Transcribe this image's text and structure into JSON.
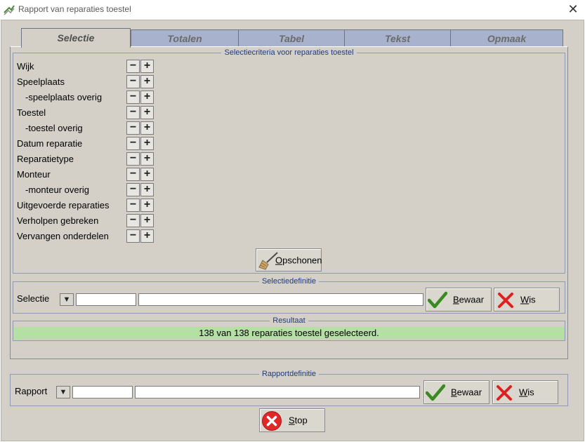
{
  "window": {
    "title": "Rapport van reparaties toestel",
    "close_glyph": "✕"
  },
  "tabs": [
    "Selectie",
    "Totalen",
    "Tabel",
    "Tekst",
    "Opmaak"
  ],
  "criteria": {
    "legend": "Selectiecriteria voor reparaties toestel",
    "items": [
      {
        "label": "Wijk",
        "sub": false
      },
      {
        "label": "Speelplaats",
        "sub": false
      },
      {
        "label": "-speelplaats overig",
        "sub": true
      },
      {
        "label": "Toestel",
        "sub": false
      },
      {
        "label": "-toestel overig",
        "sub": true
      },
      {
        "label": "Datum reparatie",
        "sub": false
      },
      {
        "label": "Reparatietype",
        "sub": false
      },
      {
        "label": "Monteur",
        "sub": false
      },
      {
        "label": "-monteur overig",
        "sub": true
      },
      {
        "label": "Uitgevoerde reparaties",
        "sub": false
      },
      {
        "label": "Verholpen gebreken",
        "sub": false
      },
      {
        "label": "Vervangen onderdelen",
        "sub": false
      }
    ],
    "minus": "−",
    "plus": "+",
    "opschonen": {
      "mnemonic": "O",
      "rest": "pschonen"
    }
  },
  "selectiedefinitie": {
    "legend": "Selectiedefinitie",
    "label": "Selectie",
    "dropdown_glyph": "▼",
    "code_value": "",
    "name_value": "",
    "bewaar": {
      "mnemonic": "B",
      "rest": "ewaar"
    },
    "wis": {
      "mnemonic": "W",
      "rest": "is"
    }
  },
  "resultaat": {
    "legend": "Resultaat",
    "text": "138 van 138 reparaties toestel geselecteerd."
  },
  "rapportdefinitie": {
    "legend": "Rapportdefinitie",
    "label": "Rapport",
    "dropdown_glyph": "▼",
    "code_value": "",
    "name_value": "",
    "bewaar": {
      "mnemonic": "B",
      "rest": "ewaar"
    },
    "wis": {
      "mnemonic": "W",
      "rest": "is"
    }
  },
  "stop": {
    "mnemonic": "S",
    "rest": "top"
  },
  "colors": {
    "client_bg": "#d4d0c8",
    "tab_inactive": "#a8b2cc",
    "result_bg": "#b5e0a4",
    "legend_text": "#1f3a78",
    "check_green": "#3a8a22",
    "cross_red": "#e02020"
  }
}
